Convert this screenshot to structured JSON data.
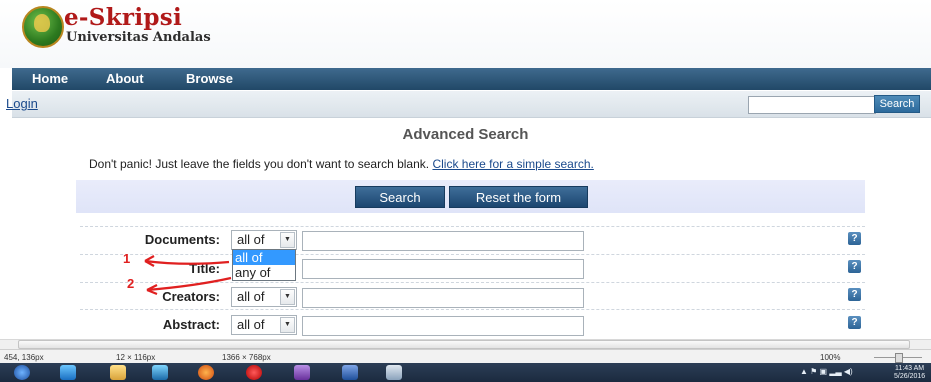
{
  "header": {
    "title": "e-Skripsi",
    "subtitle": "Universitas Andalas"
  },
  "nav": {
    "items": [
      "Home",
      "About",
      "Browse"
    ]
  },
  "topbar": {
    "login": "Login",
    "search_button": "Search",
    "search_value": ""
  },
  "main": {
    "title": "Advanced Search",
    "intro_text": "Don't panic! Just leave the fields you don't want to search blank. ",
    "intro_link": "Click here for a simple search.",
    "search_button": "Search",
    "reset_button": "Reset the form",
    "fields": [
      {
        "label": "Documents:",
        "select": "all of",
        "value": ""
      },
      {
        "label": "Title:",
        "select": "",
        "value": ""
      },
      {
        "label": "Creators:",
        "select": "all of",
        "value": ""
      },
      {
        "label": "Abstract:",
        "select": "all of",
        "value": ""
      }
    ],
    "dropdown_options": [
      "all of",
      "any of"
    ],
    "dropdown_selected": "all of",
    "help_glyph": "?",
    "annotations": [
      "1",
      "2"
    ],
    "annotation_color": "#e02020"
  },
  "status": {
    "cursor": "454, 136px",
    "selection": "12 × 116px",
    "screen": "1366 × 768px",
    "zoom": "100%"
  },
  "taskbar": {
    "time": "11:43 AM",
    "date": "5/26/2016",
    "icons": [
      "start-orb-icon",
      "ie-icon",
      "folder-icon",
      "media-icon",
      "firefox-icon",
      "opera-icon",
      "vs-icon",
      "word-icon",
      "paint-icon"
    ]
  },
  "colors": {
    "nav_bg": "#214867",
    "brand_red": "#b01919",
    "link": "#1b4a8c",
    "button": "#1c4670"
  }
}
